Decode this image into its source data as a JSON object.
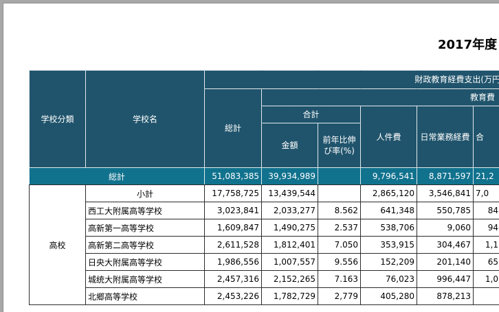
{
  "report": {
    "title": "2017年度"
  },
  "header": {
    "category": "学校分類",
    "school_name": "学校名",
    "fiscal_group": "財政教育経費支出(万円",
    "education_costs": "教育費",
    "total": "総計",
    "subtotal_group": "合計",
    "amount": "金額",
    "growth_rate": "前年比伸び率(%)",
    "personnel": "人件費",
    "daily_ops": "日常業務経費",
    "next_col_partial": "合"
  },
  "grand_total": {
    "label": "総計",
    "total": "51,083,385",
    "amount": "39,934,989",
    "growth": "",
    "personnel": "9,796,541",
    "daily_ops": "8,871,597",
    "next": "21,2"
  },
  "group": {
    "name": "高校"
  },
  "rows": [
    {
      "name": "小計",
      "total": "17,758,725",
      "amount": "13,439,544",
      "growth": "",
      "personnel": "2,865,120",
      "daily_ops": "3,546,841",
      "next": "7,0"
    },
    {
      "name": "西工大附属高等学校",
      "total": "3,023,841",
      "amount": "2,033,277",
      "growth": "8.562",
      "personnel": "641,348",
      "daily_ops": "550,785",
      "next": "84"
    },
    {
      "name": "高新第一高等学校",
      "total": "1,609,847",
      "amount": "1,490,275",
      "growth": "2.537",
      "personnel": "538,706",
      "daily_ops": "9,060",
      "next": "94"
    },
    {
      "name": "高新第二高等学校",
      "total": "2,611,528",
      "amount": "1,812,401",
      "growth": "7.050",
      "personnel": "353,915",
      "daily_ops": "304,467",
      "next": "1,1"
    },
    {
      "name": "日央大附属高等学校",
      "total": "1,986,556",
      "amount": "1,007,557",
      "growth": "9.556",
      "personnel": "152,209",
      "daily_ops": "201,140",
      "next": "65"
    },
    {
      "name": "城统大附属高等学校",
      "total": "2,457,316",
      "amount": "2,152,265",
      "growth": "7.163",
      "personnel": "76,023",
      "daily_ops": "996,447",
      "next": "1,0"
    },
    {
      "name": "北郷高等学校",
      "total": "2,453,226",
      "amount": "1,782,729",
      "growth": "2,779",
      "personnel": "405,280",
      "daily_ops": "878,213",
      "next": ""
    }
  ]
}
